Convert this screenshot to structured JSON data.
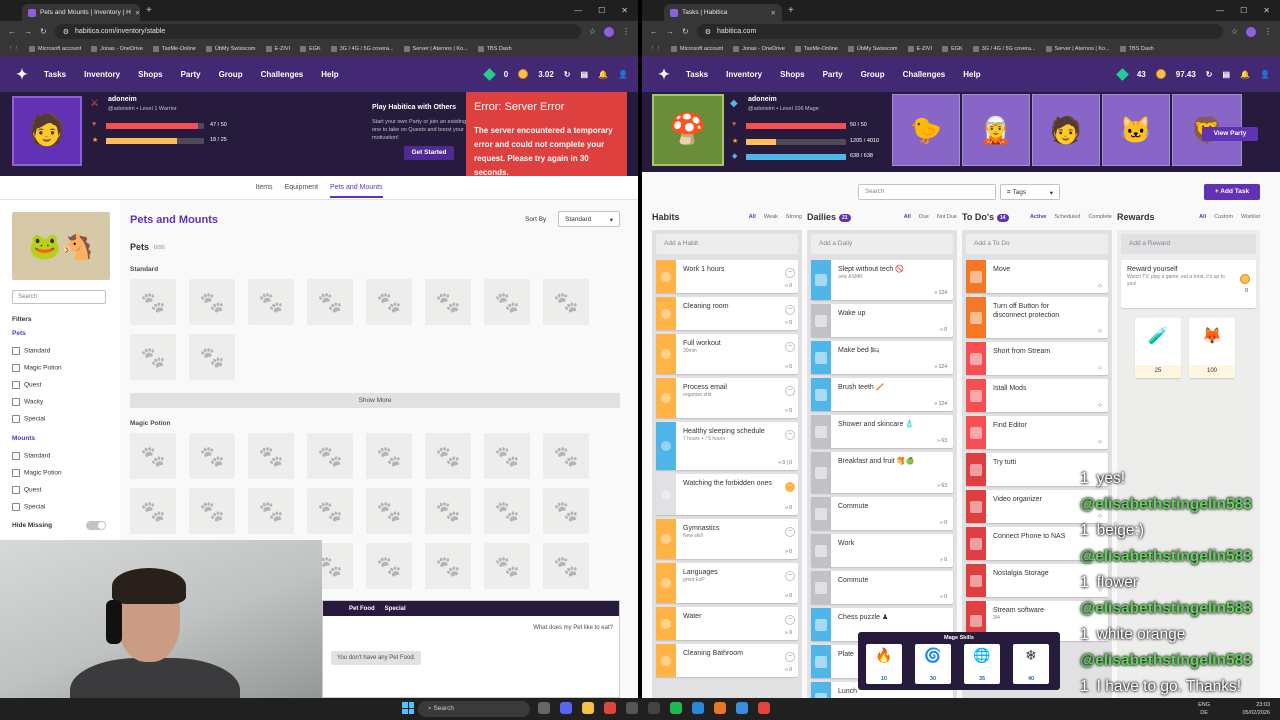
{
  "left": {
    "tab_title": "Pets and Mounts | Inventory | H",
    "url": "habitica.com/inventory/stable",
    "bookmarks": [
      "Microsoft account",
      "Jonas - OneDrive",
      "TaxMe-Online",
      "ÜbMy Swisscom",
      "E-ZIVI",
      "EGK",
      "3G / 4G / 5G covera...",
      "Server | Aternos | Ko...",
      "TBS Dash"
    ],
    "nav": [
      "Tasks",
      "Inventory",
      "Shops",
      "Party",
      "Group",
      "Challenges",
      "Help"
    ],
    "gems": "0",
    "gold": "3.02",
    "user": {
      "name": "adoneim",
      "sub": "@adoneim • Level 1 Warrior",
      "hp": "47 / 50",
      "exp": "18 / 25",
      "hp_frac": 0.94,
      "exp_frac": 0.72
    },
    "promo": {
      "title": "Play Habitica with Others",
      "text": "Start your own Party or join an existing one to take on Quests and boost your motivation!",
      "button": "Get Started"
    },
    "error": {
      "title": "Error: Server Error",
      "body": "The server encountered a temporary error and could not complete your request. Please try again in 30 seconds."
    },
    "subnav": [
      "Items",
      "Equipment",
      "Pets and Mounts"
    ],
    "sidebar": {
      "search": "Search",
      "filters": "Filters",
      "pets": "Pets",
      "pet_filters": [
        "Standard",
        "Magic Potion",
        "Quest",
        "Wacky",
        "Special"
      ],
      "mounts": "Mounts",
      "mount_filters": [
        "Standard",
        "Magic Potion",
        "Quest",
        "Special"
      ],
      "hide_missing": "Hide Missing"
    },
    "main": {
      "title": "Pets and Mounts",
      "sort_label": "Sort By",
      "sort_value": "Standard",
      "pets_label": "Pets",
      "pets_count": "0/90",
      "standard": "Standard",
      "show_more": "Show More",
      "magic_potion": "Magic Potion"
    },
    "food": {
      "tabs": [
        "Pet Food",
        "Special"
      ],
      "question": "What does my Pet like to eat?",
      "empty": "You don't have any Pet Food."
    }
  },
  "right": {
    "tab_title": "Tasks | Habitica",
    "url": "habitica.com",
    "bookmarks": [
      "Microsoft account",
      "Jonas - OneDrive",
      "TaxMe-Online",
      "ÜbMy Swisscom",
      "E-ZIVI",
      "EGK",
      "3G / 4G / 5G covera...",
      "Server | Aternos | Ko...",
      "TBS Dash"
    ],
    "nav": [
      "Tasks",
      "Inventory",
      "Shops",
      "Party",
      "Group",
      "Challenges",
      "Help"
    ],
    "gems": "43",
    "gold": "97.43",
    "user": {
      "name": "adoneim",
      "sub": "@adoneim • Level 106 Mage",
      "hp": "50 / 50",
      "exp": "1205 / 4010",
      "mp": "638 / 638",
      "hp_frac": 1,
      "exp_frac": 0.3,
      "mp_frac": 1
    },
    "view_party": "View Party",
    "search": "Search",
    "tags": "Tags",
    "add_task": "Add Task",
    "habits": {
      "title": "Habits",
      "filters": [
        "All",
        "Weak",
        "Strong"
      ],
      "add": "Add a Habit",
      "items": [
        {
          "t": "Work 1 hours",
          "n": "",
          "m": "» 0",
          "c": "#ffb445"
        },
        {
          "t": "Cleaning room",
          "n": "",
          "m": "» 0",
          "c": "#ffb445"
        },
        {
          "t": "Full workout",
          "n": "30min",
          "m": "» 0",
          "c": "#ffb445"
        },
        {
          "t": "Process email",
          "n": "organize shit",
          "m": "» 0",
          "c": "#ffb445"
        },
        {
          "t": "Healthy sleeping schedule",
          "n": "7 hours + / 5 hours -",
          "m": "» 0 | 0",
          "c": "#50b5e9"
        },
        {
          "t": "Watching the forbidden ones",
          "n": "",
          "m": "» 0",
          "c": "#e1e0e3"
        },
        {
          "t": "Gymnastics",
          "n": "New skill",
          "m": "» 0",
          "c": "#ffb445"
        },
        {
          "t": "Languages",
          "n": "grind ExP",
          "m": "» 0",
          "c": "#ffb445"
        },
        {
          "t": "Water",
          "n": "",
          "m": "» 0",
          "c": "#ffb445"
        },
        {
          "t": "Cleaning Bathroom",
          "n": "",
          "m": "» 0",
          "c": "#ffb445"
        }
      ]
    },
    "dailies": {
      "title": "Dailies",
      "count": "21",
      "filters": [
        "All",
        "Due",
        "Not Due"
      ],
      "add": "Add a Daily",
      "items": [
        {
          "t": "Slept without tech 🚫",
          "n": "only ASMR",
          "m": "» 124",
          "c": "#50b5e9"
        },
        {
          "t": "Wake up",
          "n": "",
          "m": "» 0",
          "c": "#c3c0c7"
        },
        {
          "t": "Make bed 🛏",
          "n": "",
          "m": "» 124",
          "c": "#50b5e9"
        },
        {
          "t": "Brush teeth 🪥",
          "n": "",
          "m": "» 124",
          "c": "#50b5e9"
        },
        {
          "t": "Shower and skincare 🧴",
          "n": "",
          "m": "» 63",
          "c": "#c3c0c7"
        },
        {
          "t": "Breakfast and fruit 🥞🍏",
          "n": "",
          "m": "» 63",
          "c": "#c3c0c7"
        },
        {
          "t": "Commute",
          "n": "",
          "m": "» 0",
          "c": "#c3c0c7"
        },
        {
          "t": "Work",
          "n": "",
          "m": "» 0",
          "c": "#c3c0c7"
        },
        {
          "t": "Commute",
          "n": "",
          "m": "» 0",
          "c": "#c3c0c7"
        },
        {
          "t": "Chess puzzle ♟",
          "n": "",
          "m": "",
          "c": "#50b5e9"
        },
        {
          "t": "Plate",
          "n": "",
          "m": "",
          "c": "#50b5e9"
        },
        {
          "t": "Lunch",
          "n": "",
          "m": "",
          "c": "#50b5e9"
        }
      ]
    },
    "todos": {
      "title": "To Do's",
      "count": "14",
      "filters": [
        "Active",
        "Scheduled",
        "Complete"
      ],
      "add": "Add a To Do",
      "items": [
        {
          "t": "Move",
          "n": "",
          "c": "#f47825"
        },
        {
          "t": "Turn off Button for disconnect protection",
          "n": "",
          "c": "#f47825"
        },
        {
          "t": "Short from Stream",
          "n": "",
          "c": "#f74e52"
        },
        {
          "t": "Istall Mods",
          "n": "",
          "c": "#f74e52"
        },
        {
          "t": "Find Editor",
          "n": "",
          "c": "#f74e52"
        },
        {
          "t": "Try tutti",
          "n": "",
          "c": "#de3f3f"
        },
        {
          "t": "Video organizer",
          "n": "",
          "c": "#de3f3f"
        },
        {
          "t": "Connect Phone to NAS",
          "n": "",
          "c": "#de3f3f"
        },
        {
          "t": "Nostalgia Storage",
          "n": "",
          "c": "#de3f3f"
        },
        {
          "t": "Stream software",
          "n": "3/4",
          "c": "#de3f3f"
        }
      ]
    },
    "rewards": {
      "title": "Rewards",
      "filters": [
        "All",
        "Custom",
        "Wishlist"
      ],
      "add": "Add a Reward",
      "custom": {
        "t": "Reward yourself",
        "n": "Watch TV, play a game, eat a treat, it's up to you!",
        "p": "0"
      },
      "items": [
        {
          "p": "25",
          "i": "🧪"
        },
        {
          "p": "100",
          "i": "🦊"
        }
      ]
    },
    "skills": {
      "title": "Mage Skills",
      "items": [
        {
          "v": "10",
          "i": "🔥"
        },
        {
          "v": "30",
          "i": "🌀"
        },
        {
          "v": "35",
          "i": "🌐"
        },
        {
          "v": "40",
          "i": "❄"
        }
      ]
    }
  },
  "chat": [
    {
      "u": "1",
      "m": "yes!"
    },
    {
      "u": "@elisabethstingelin583",
      "m": ""
    },
    {
      "u": "1",
      "m": "beige:)"
    },
    {
      "u": "@elisabethstingelin583",
      "m": ""
    },
    {
      "u": "1",
      "m": "flower"
    },
    {
      "u": "@elisabethstingelin583",
      "m": ""
    },
    {
      "u": "1",
      "m": "white orange"
    },
    {
      "u": "@elisabethstingelin583",
      "m": ""
    },
    {
      "u": "1",
      "m": "I have to go. Thanks!"
    }
  ],
  "taskbar": {
    "search": "Search",
    "lang": "ENG",
    "region": "DE",
    "time": "23:03",
    "date": "05/02/2026"
  }
}
